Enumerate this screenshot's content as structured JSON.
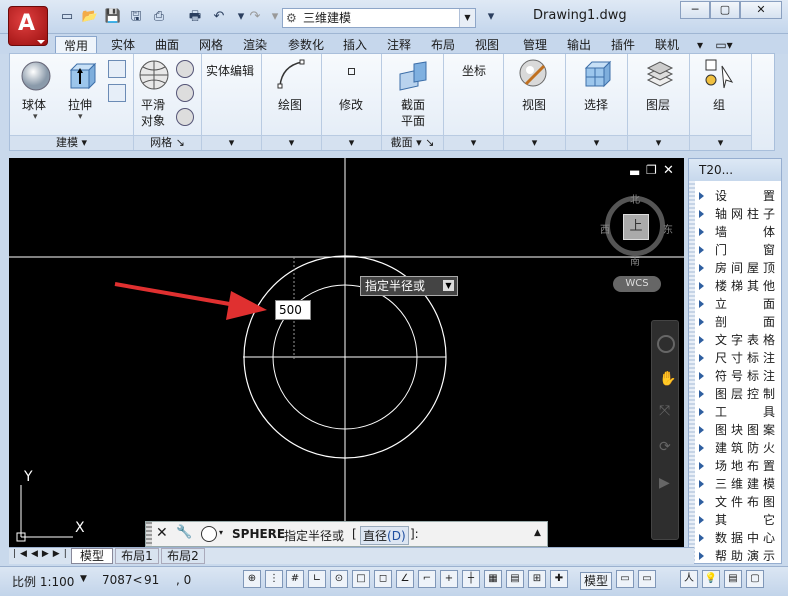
{
  "titlebar": {
    "workspace": "三维建模",
    "doc_title": "Drawing1.dwg",
    "app_logo_letter": "A"
  },
  "tabs": [
    "常用",
    "实体",
    "曲面",
    "网格",
    "渲染",
    "参数化",
    "插入",
    "注释",
    "布局",
    "视图",
    "管理",
    "输出",
    "插件",
    "联机"
  ],
  "ribbon": {
    "sphere": "球体",
    "extrude": "拉伸",
    "smooth_object_1": "平滑",
    "smooth_object_2": "对象",
    "solid_edit": "实体编辑",
    "draw": "绘图",
    "modify": "修改",
    "section_plane_1": "截面",
    "section_plane_2": "平面",
    "coordinates": "坐标",
    "view": "视图",
    "select": "选择",
    "layers": "图层",
    "groups": "组",
    "panel_modeling": "建模 ▾",
    "panel_mesh": "网格",
    "panel_section": "截面 ▾"
  },
  "viewcube": {
    "north": "北",
    "south": "南",
    "east": "东",
    "west": "西",
    "top_face": "上",
    "wcs": "WCS"
  },
  "canvas": {
    "dim_input": "500",
    "tooltip": "指定半径或",
    "ucs_x": "X",
    "ucs_y": "Y"
  },
  "palette": {
    "title": "T20...",
    "items": [
      "设　置",
      "轴网柱子",
      "墙　体",
      "门　窗",
      "房间屋顶",
      "楼梯其他",
      "立　面",
      "剖　面",
      "文字表格",
      "尺寸标注",
      "符号标注",
      "图层控制",
      "工　具",
      "图块图案",
      "建筑防火",
      "场地布置",
      "三维建模",
      "文件布图",
      "其　它",
      "数据中心",
      "帮助演示"
    ]
  },
  "command": {
    "cmd_name": "SPHERE",
    "prompt": "指定半径或",
    "option_open": "[",
    "option_label": "直径",
    "option_key": "(D)",
    "option_close": "]:"
  },
  "layout_tabs": [
    "模型",
    "布局1",
    "布局2"
  ],
  "statusbar": {
    "scale": "比例 1:100",
    "coords_x": "7087<",
    "coords_y": "91",
    "coords_z": ", 0",
    "model": "模型"
  }
}
